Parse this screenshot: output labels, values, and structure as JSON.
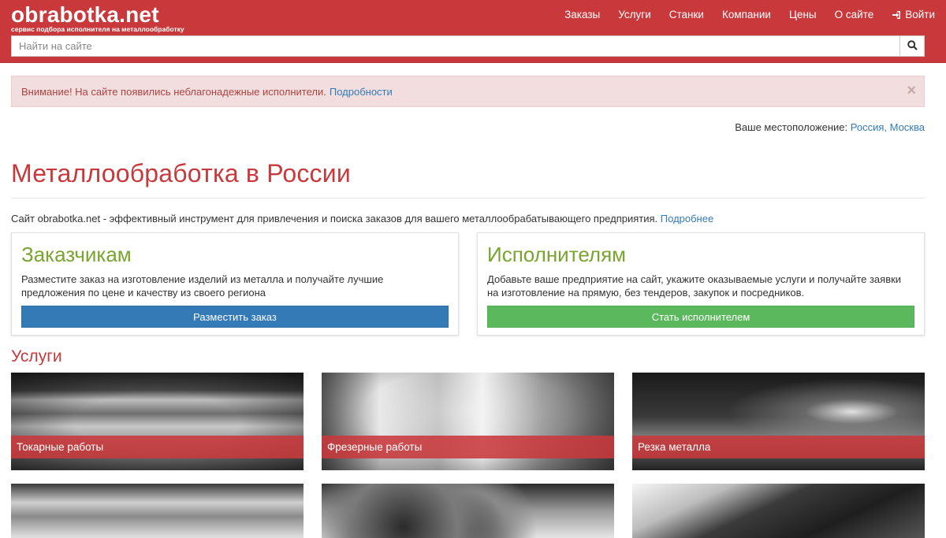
{
  "header": {
    "logo_title": "obrabotka.net",
    "logo_subtitle": "сервис подбора исполнителя на металлообработку",
    "nav": [
      {
        "label": "Заказы"
      },
      {
        "label": "Услуги"
      },
      {
        "label": "Станки"
      },
      {
        "label": "Компании"
      },
      {
        "label": "Цены"
      },
      {
        "label": "О сайте"
      }
    ],
    "login_label": "Войти",
    "search_placeholder": "Найти на сайте"
  },
  "alert": {
    "text": "Внимание! На сайте появились неблагонадежные исполнители.",
    "link": "Подробности",
    "close": "×"
  },
  "location": {
    "label": "Ваше местоположение:",
    "value": "Россия, Москва"
  },
  "main": {
    "title": "Металлообработка в России",
    "intro_text": "Сайт obrabotka.net - эффективный инструмент для привлечения и поиска заказов для вашего металлообрабатывающего предприятия.",
    "intro_link": "Подробнее"
  },
  "cards": [
    {
      "title": "Заказчикам",
      "text": "Разместите заказ на изготовление изделий из металла и получайте лучшие предложения по цене и качеству из своего региона",
      "button": "Разместить заказ"
    },
    {
      "title": "Исполнителям",
      "text": "Добавьте ваше предприятие на сайт, укажите оказываемые услуги и получайте заявки на изготовление на прямую, без тендеров, закупок и посредников.",
      "button": "Стать исполнителем"
    }
  ],
  "services": {
    "title": "Услуги",
    "items": [
      {
        "label": "Токарные работы"
      },
      {
        "label": "Фрезерные работы"
      },
      {
        "label": "Резка металла"
      }
    ]
  },
  "colors": {
    "brand": "#c9393c",
    "link": "#337ab7",
    "accent_green": "#7aa32f",
    "btn_blue": "#337ab7",
    "btn_green": "#5cb85c"
  }
}
